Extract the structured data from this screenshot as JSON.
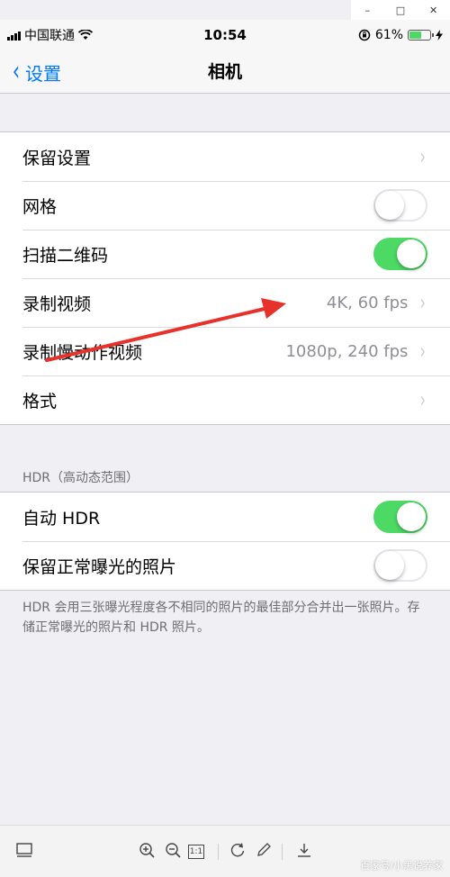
{
  "window": {
    "minimize": "–",
    "maximize": "□",
    "close": "✕"
  },
  "status": {
    "carrier": "中国联通",
    "time": "10:54",
    "battery": "61%"
  },
  "nav": {
    "back_label": "设置",
    "title": "相机"
  },
  "group1": {
    "rows": [
      {
        "label": "保留设置",
        "value": ""
      },
      {
        "label": "网格",
        "toggle": "off"
      },
      {
        "label": "扫描二维码",
        "toggle": "on"
      },
      {
        "label": "录制视频",
        "value": "4K, 60 fps"
      },
      {
        "label": "录制慢动作视频",
        "value": "1080p, 240 fps"
      },
      {
        "label": "格式",
        "value": ""
      }
    ]
  },
  "hdr": {
    "header": "HDR（高动态范围）",
    "rows": [
      {
        "label": "自动 HDR",
        "toggle": "on"
      },
      {
        "label": "保留正常曝光的照片",
        "toggle": "off"
      }
    ],
    "footer": "HDR 会用三张曝光程度各不相同的照片的最佳部分合并出一张照片。存储正常曝光的照片和 HDR 照片。"
  },
  "toolbar": {
    "icons": [
      "thumbnail-icon",
      "zoom-in-icon",
      "zoom-out-icon",
      "actual-size-icon",
      "rotate-icon",
      "edit-icon",
      "download-icon"
    ],
    "actual_size_label": "1:1",
    "watermark": "百家号/小黑说养家"
  },
  "colors": {
    "accent": "#007aff",
    "toggle_on": "#4cd964",
    "background": "#efeff4",
    "arrow": "#e8312b"
  }
}
